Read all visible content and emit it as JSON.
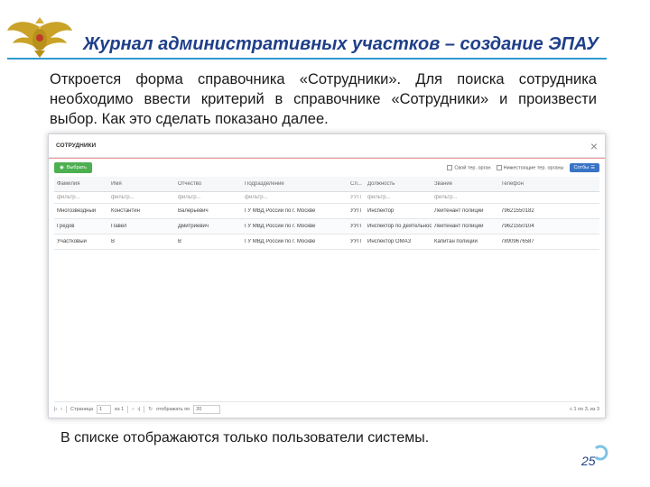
{
  "slide": {
    "title": "Журнал административных участков – создание ЭПАУ",
    "intro": "Откроется форма справочника «Сотрудники». Для поиска сотрудника необходимо ввести критерий в справочнике «Сотрудники» и произвести выбор. Как это сделать показано далее.",
    "note": "В списке отображаются только пользователи системы.",
    "page_number": "25",
    "accent_color": "#2e9ad0",
    "title_color": "#1f3f8a"
  },
  "window": {
    "title": "СОТРУДНИКИ",
    "close_label": "×",
    "select_button": "Выбрать",
    "own_org_checkbox": "Свой тер. орган",
    "multi_org_checkbox": "Нижестоящие тер. органы",
    "staff_button": "Сотбы"
  },
  "table": {
    "columns": [
      "Фамилия",
      "Имя",
      "Отчество",
      "Подразделение",
      "Сл...",
      "Должность",
      "Звание",
      "Телефон"
    ],
    "filters": [
      "фильтр...",
      "фильтр...",
      "фильтр...",
      "фильтр...",
      "УУП",
      "фильтр...",
      "фильтр...",
      ""
    ],
    "rows": [
      [
        "Многозвездный",
        "Константин",
        "Валерьевич",
        "ГУ МВД России по г. Москве",
        "УУП",
        "Инспектор",
        "Лейтенант полиции",
        "79621550182"
      ],
      [
        "Гредов",
        "Павел",
        "Дмитриевич",
        "ГУ МВД России по г. Москве",
        "УУП",
        "Инспектор по деятельност...",
        "Лейтенант полиции",
        "79621550104"
      ],
      [
        "Участковый",
        "В",
        "В",
        "ГУ МВД России по г. Москве",
        "УУП",
        "Инспектор ОМАЗ",
        "Капитан полиции",
        "78909676587"
      ]
    ]
  },
  "pagination": {
    "page_label": "Страница",
    "page_value": "1",
    "of_label": "из 1",
    "per_page_label": "отображать по",
    "per_page_value": "20",
    "summary": "с 1 по 3, из 3"
  }
}
